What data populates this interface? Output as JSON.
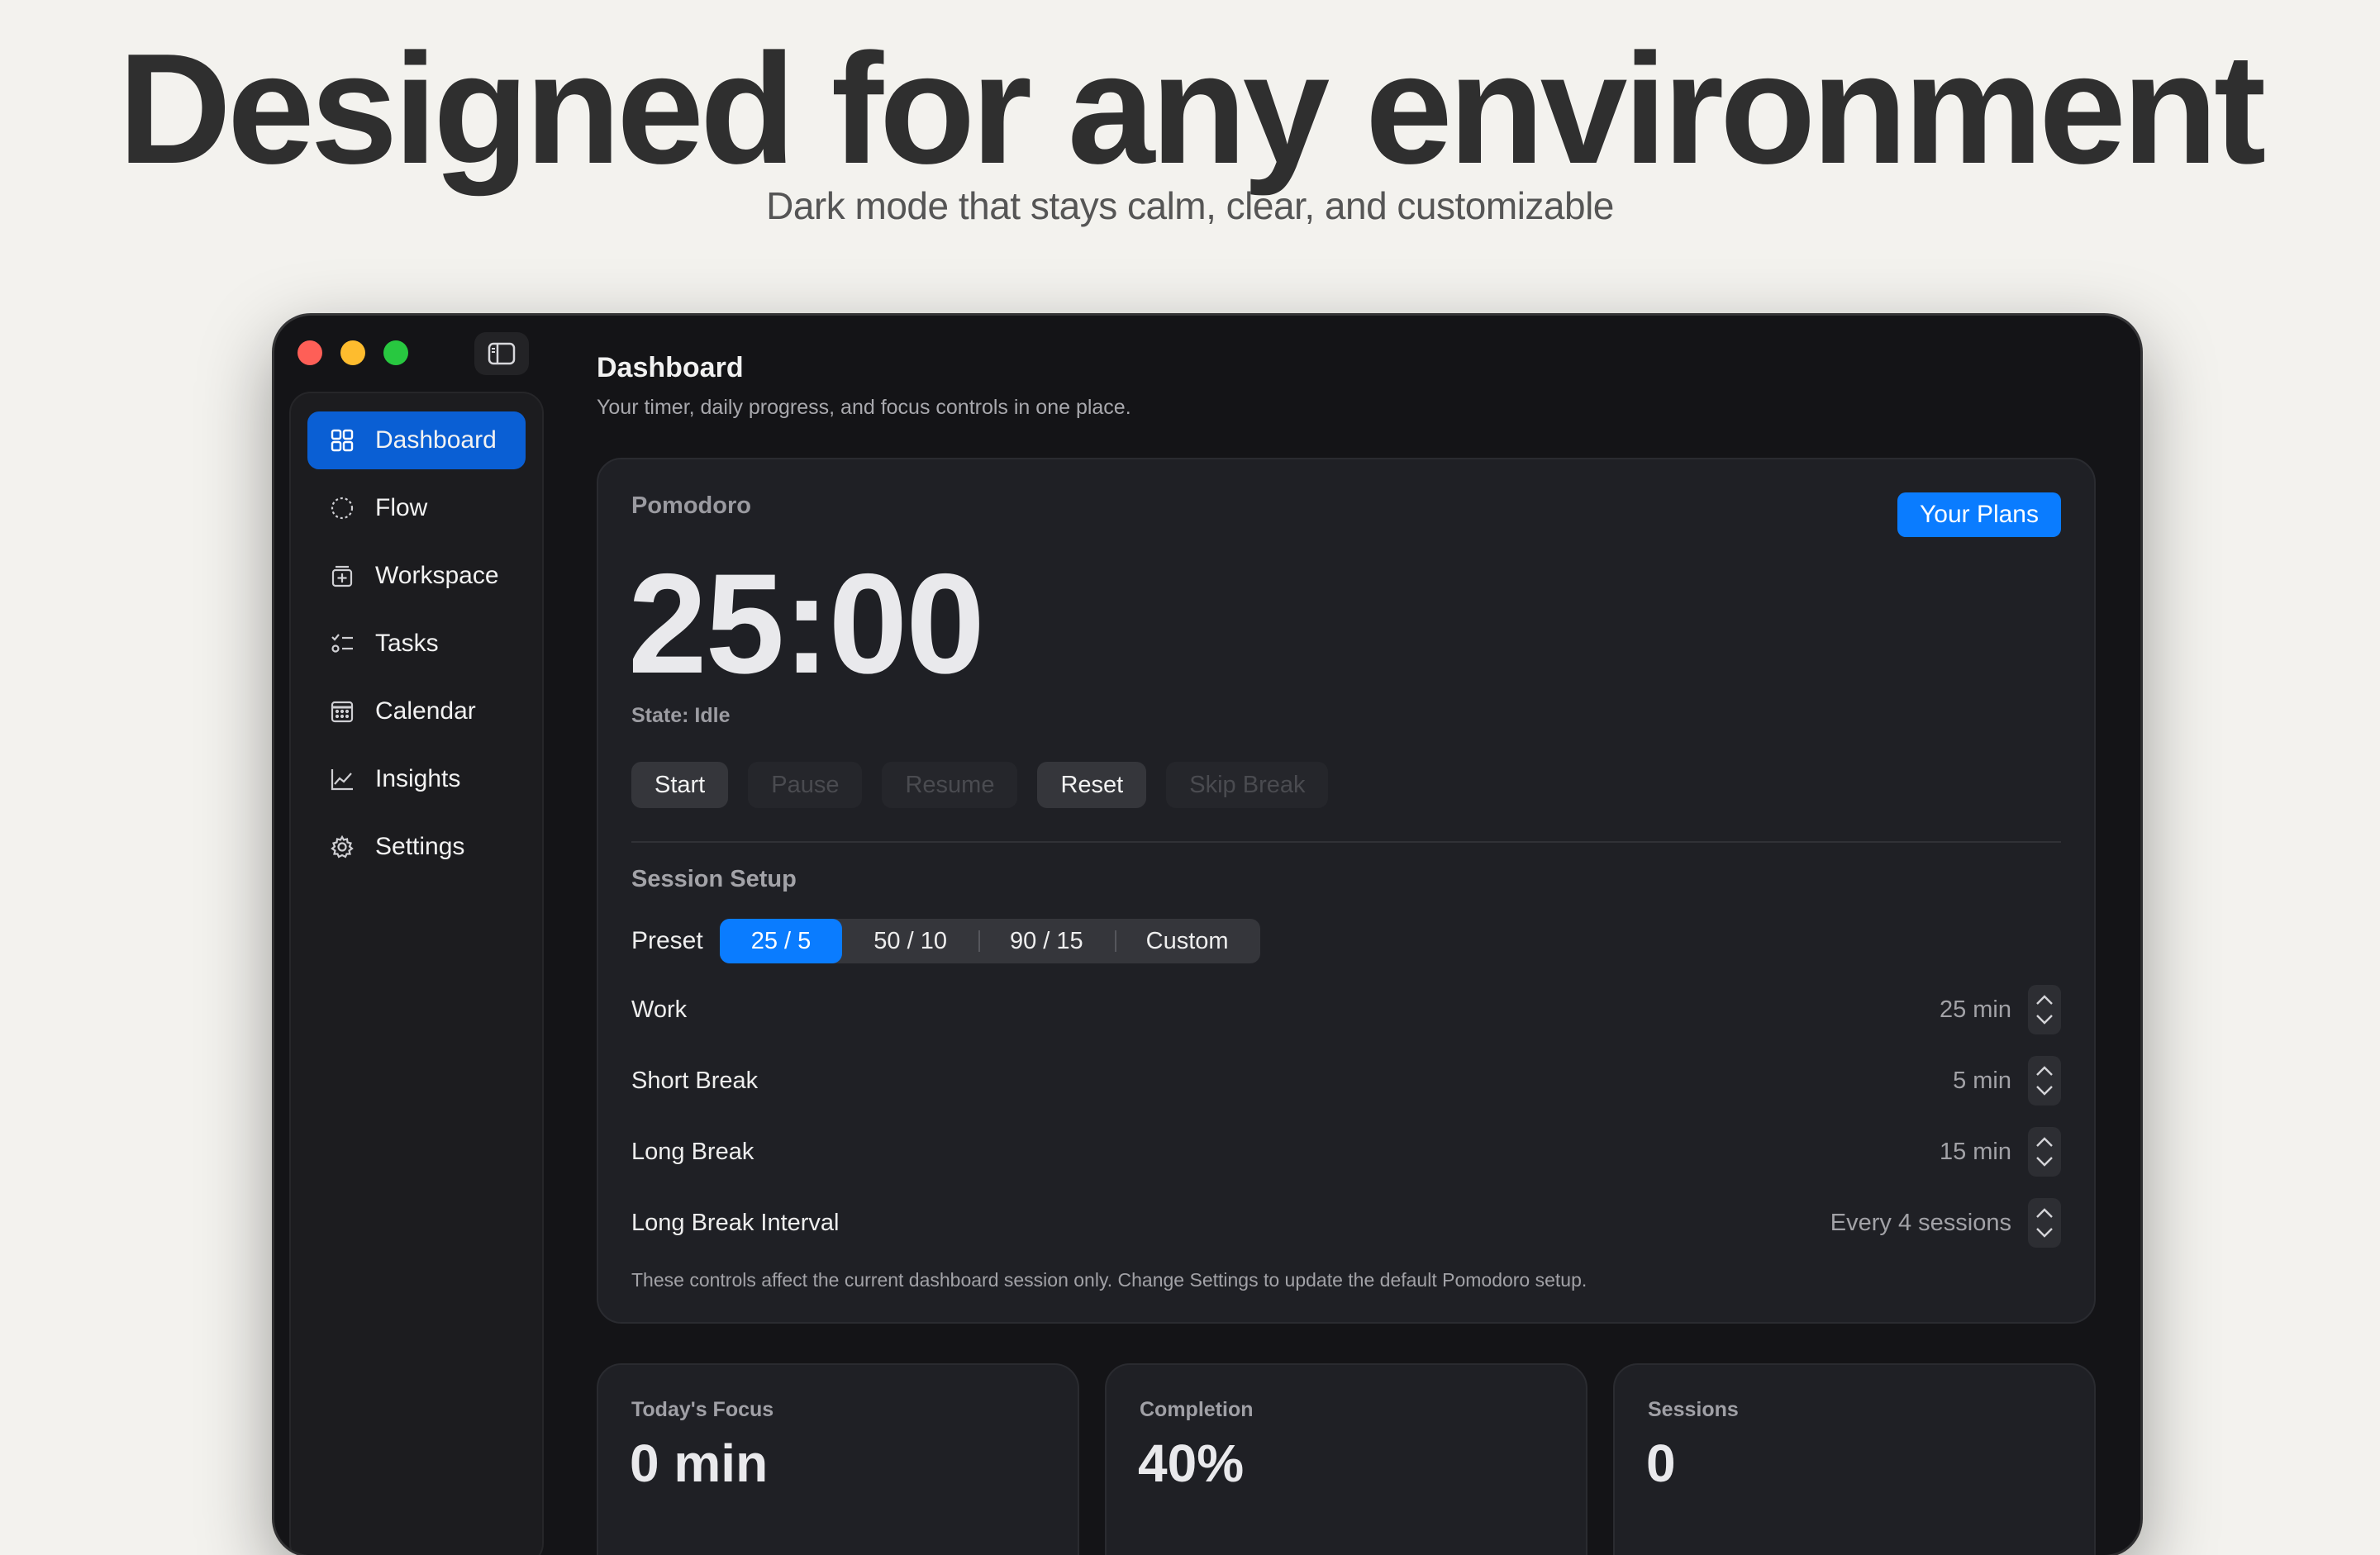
{
  "hero": {
    "title": "Designed for any environment",
    "subtitle": "Dark mode that stays calm, clear, and customizable"
  },
  "window": {
    "controls": [
      "close",
      "minimize",
      "zoom"
    ],
    "sidebar_toggle_icon": "sidebar-toggle-icon"
  },
  "sidebar": {
    "items": [
      {
        "label": "Dashboard",
        "icon": "grid-icon",
        "active": true
      },
      {
        "label": "Flow",
        "icon": "dashed-circle-icon"
      },
      {
        "label": "Workspace",
        "icon": "add-box-icon"
      },
      {
        "label": "Tasks",
        "icon": "checklist-icon"
      },
      {
        "label": "Calendar",
        "icon": "calendar-icon"
      },
      {
        "label": "Insights",
        "icon": "chart-line-icon"
      },
      {
        "label": "Settings",
        "icon": "gear-icon"
      }
    ]
  },
  "header": {
    "title": "Dashboard",
    "description": "Your timer, daily progress, and focus controls in one place."
  },
  "pomodoro": {
    "label": "Pomodoro",
    "plans_button": "Your Plans",
    "time": "25:00",
    "state": "State: Idle",
    "buttons": {
      "start": "Start",
      "pause": "Pause",
      "resume": "Resume",
      "reset": "Reset",
      "skip_break": "Skip Break"
    }
  },
  "session_setup": {
    "title": "Session Setup",
    "preset_label": "Preset",
    "presets": [
      "25 / 5",
      "50 / 10",
      "90 / 15",
      "Custom"
    ],
    "selected_preset": "25 / 5",
    "rows": [
      {
        "label": "Work",
        "value": "25 min"
      },
      {
        "label": "Short Break",
        "value": "5 min"
      },
      {
        "label": "Long Break",
        "value": "15 min"
      },
      {
        "label": "Long Break Interval",
        "value": "Every 4 sessions"
      }
    ],
    "note": "These controls affect the current dashboard session only. Change Settings to update the default Pomodoro setup."
  },
  "stats": [
    {
      "label": "Today's Focus",
      "value": "0 min"
    },
    {
      "label": "Completion",
      "value": "40%"
    },
    {
      "label": "Sessions",
      "value": "0"
    }
  ],
  "colors": {
    "accent": "#0a7cff",
    "sidebar_active": "#0a5fd4",
    "window_bg": "#141417",
    "card_bg": "#1f2025",
    "page_bg": "#f3f2ee"
  }
}
